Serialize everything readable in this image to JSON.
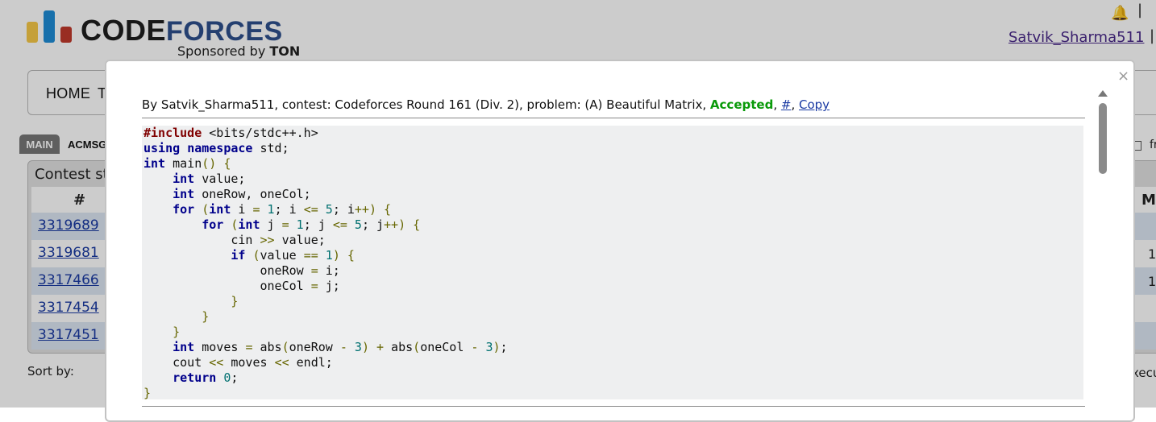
{
  "header": {
    "logo_code": "CODE",
    "logo_forces": "FORCES",
    "sponsor_prefix": "Sponsored by ",
    "sponsor_brand": "TON",
    "user": "Satvik_Sharma511",
    "pipe": "|"
  },
  "menu": {
    "home": "HOME",
    "next_partial": "TO"
  },
  "subtabs": {
    "main": "MAIN",
    "acm": "ACMSGU"
  },
  "status": {
    "title": "Contest st",
    "hash_header": "#",
    "rows": [
      "3319689",
      "3319681",
      "3317466",
      "3317454",
      "3317451"
    ],
    "right_header": "Me",
    "right_values": [
      "1",
      "1"
    ],
    "right_fr": "fr",
    "right_exec": "xecu"
  },
  "sort_by": "Sort by:",
  "modal": {
    "close": "×",
    "info_prefix": "By Satvik_Sharma511, contest: Codeforces Round 161 (Div. 2), problem: (A) Beautiful Matrix, ",
    "verdict": "Accepted",
    "sep": ", ",
    "hash_link": "#",
    "copy_link": "Copy"
  },
  "colors": {
    "accepted": "#0a9a0a",
    "link": "#1a3aa3",
    "keyword": "#00008b",
    "preprocessor": "#800000"
  }
}
